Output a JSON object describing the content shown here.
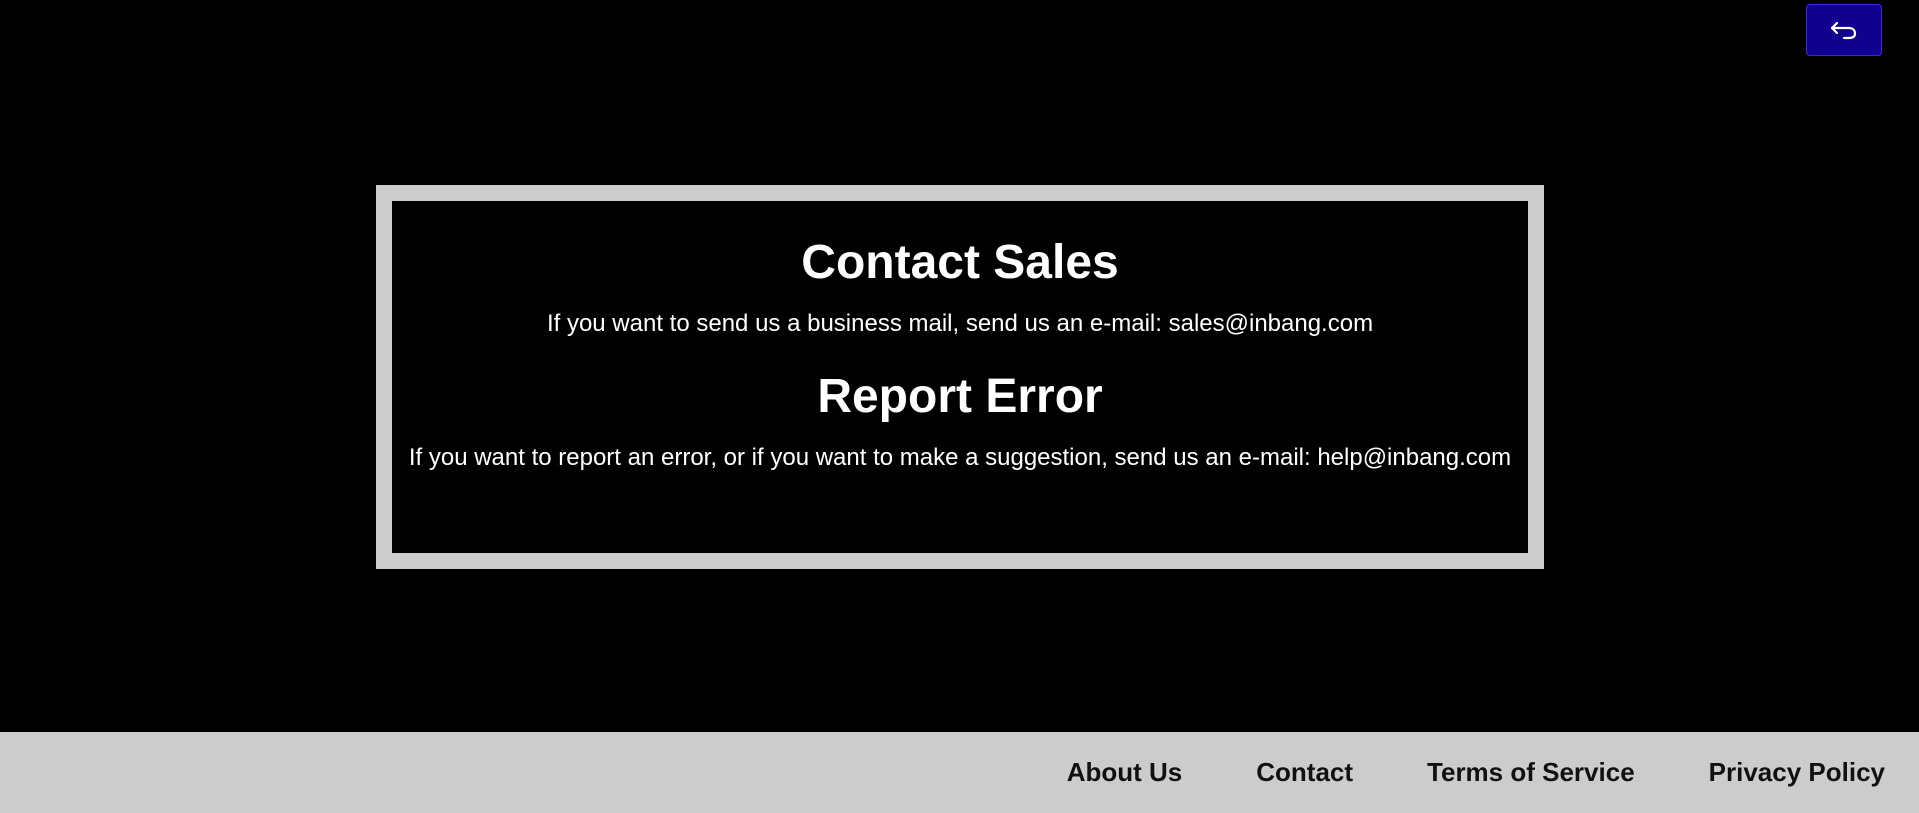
{
  "header": {
    "back_icon": "back-arrow-icon"
  },
  "contact_sales": {
    "title": "Contact Sales",
    "text": "If you want to send us a business mail, send us an e-mail: sales@inbang.com"
  },
  "report_error": {
    "title": "Report Error",
    "text": "If you want to report an error, or if you want to make a suggestion, send us an e-mail: help@inbang.com"
  },
  "footer": {
    "links": [
      {
        "label": "About Us"
      },
      {
        "label": "Contact"
      },
      {
        "label": "Terms of Service"
      },
      {
        "label": "Privacy Policy"
      }
    ]
  },
  "colors": {
    "background": "#000000",
    "panel_border": "#cccccc",
    "back_button": "#12008f",
    "footer_bg": "#cccccc",
    "text_light": "#ffffff",
    "text_dark": "#111111"
  }
}
